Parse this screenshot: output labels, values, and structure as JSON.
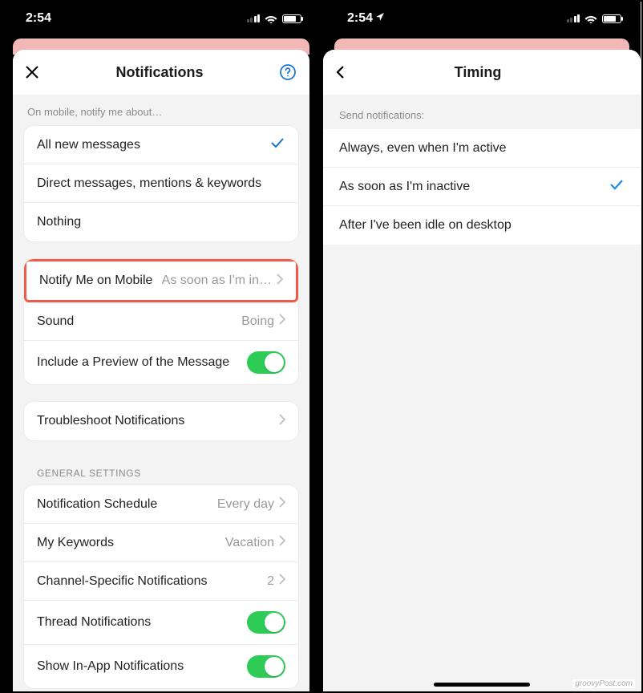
{
  "statusbar": {
    "time": "2:54"
  },
  "left": {
    "header": {
      "title": "Notifications"
    },
    "hint1": "On mobile, notify me about…",
    "options": {
      "all": "All new messages",
      "dm": "Direct messages, mentions & keywords",
      "nothing": "Nothing"
    },
    "settings": {
      "notify_mobile": {
        "label": "Notify Me on Mobile",
        "value": "As soon as I'm in…"
      },
      "sound": {
        "label": "Sound",
        "value": "Boing"
      },
      "preview": {
        "label": "Include a Preview of the Message"
      }
    },
    "troubleshoot": "Troubleshoot Notifications",
    "general_title": "GENERAL SETTINGS",
    "general": {
      "schedule": {
        "label": "Notification Schedule",
        "value": "Every day"
      },
      "keywords": {
        "label": "My Keywords",
        "value": "Vacation"
      },
      "channel": {
        "label": "Channel-Specific Notifications",
        "value": "2"
      },
      "thread": {
        "label": "Thread Notifications"
      },
      "inapp": {
        "label": "Show In-App Notifications"
      }
    }
  },
  "right": {
    "header": {
      "title": "Timing"
    },
    "hint": "Send notifications:",
    "options": {
      "always": "Always, even when I'm active",
      "inactive": "As soon as I'm inactive",
      "idle": "After I've been idle on desktop"
    }
  },
  "watermark": "groovyPost.com"
}
